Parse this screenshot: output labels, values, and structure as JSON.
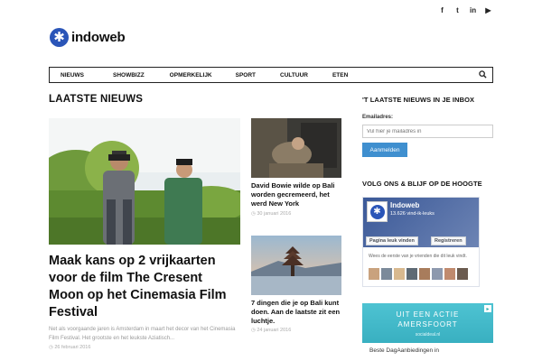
{
  "social": {
    "icons": [
      "facebook-icon",
      "twitter-icon",
      "linkedin-icon",
      "youtube-icon"
    ],
    "glyphs": [
      "f",
      "t",
      "in",
      "▶"
    ]
  },
  "brand": {
    "name": "indoweb",
    "glyph": "✱",
    "color": "#2a55b8"
  },
  "nav": {
    "items": [
      "NIEUWS",
      "SHOWBIZZ",
      "OPMERKELIJK",
      "SPORT",
      "CULTUUR",
      "ETEN"
    ],
    "search_icon": "search-icon"
  },
  "main": {
    "section_title": "LAATSTE NIEUWS",
    "hero": {
      "title": "Maak kans op 2 vrijkaarten voor de film The Cresent Moon op het Cinemasia Film Festival",
      "excerpt": "Net als voorgaande jaren is Amsterdam in maart het decor van het Cinemasia Film Festival. Het grootste en het leukste Aziatisch...",
      "date": "26 februari 2016"
    },
    "side_articles": [
      {
        "title": "David Bowie wilde op Bali worden gecremeerd, het werd New York",
        "date": "30 januari 2016"
      },
      {
        "title": "7 dingen die je op Bali kunt doen. Aan de laatste zit een luchtje.",
        "date": "24 januari 2016"
      }
    ]
  },
  "sidebar": {
    "newsletter_title": "'T LAATSTE NIEUWS IN JE INBOX",
    "email_label": "Emailadres:",
    "email_placeholder": "Vul hier je mailadres in",
    "submit_label": "Aanmelden",
    "follow_title": "VOLG ONS & BLIJF OP DE HOOGTE",
    "facebook": {
      "page_name": "Indoweb",
      "likes": "13.626 vind-ik-leuks",
      "like_button": "Pagina leuk vinden",
      "register_button": "Registreren",
      "friends_text": "Wees de eerste van je vrienden die dit leuk vindt."
    },
    "ad": {
      "line1": "UIT EEN ACTIE",
      "line2": "AMERSFOORT",
      "source": "socialdeal.nl",
      "bottom_text": "Beste DagAanbiedingen in"
    }
  },
  "colors": {
    "accent": "#3f8fcf",
    "facebook": "#3b5998",
    "ad": "#2fa7b9"
  }
}
